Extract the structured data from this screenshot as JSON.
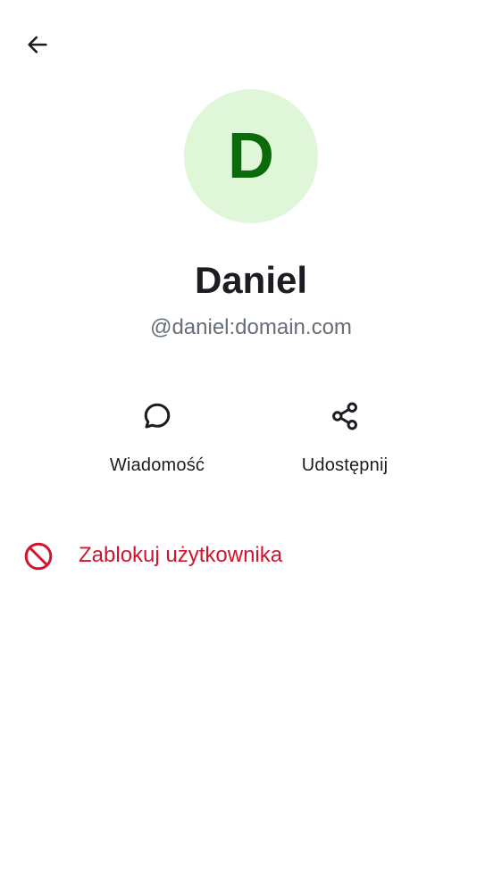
{
  "header": {
    "back_icon": "arrow-left-icon"
  },
  "profile": {
    "avatar_initial": "D",
    "avatar_bg": "#dff6d9",
    "avatar_fg": "#0b6b0b",
    "display_name": "Daniel",
    "user_id": "@daniel:domain.com"
  },
  "actions": [
    {
      "label": "Wiadomość",
      "icon": "chat-bubble-icon"
    },
    {
      "label": "Udostępnij",
      "icon": "share-icon"
    }
  ],
  "block": {
    "label": "Zablokuj użytkownika",
    "icon": "block-icon",
    "color": "#d0152f"
  }
}
